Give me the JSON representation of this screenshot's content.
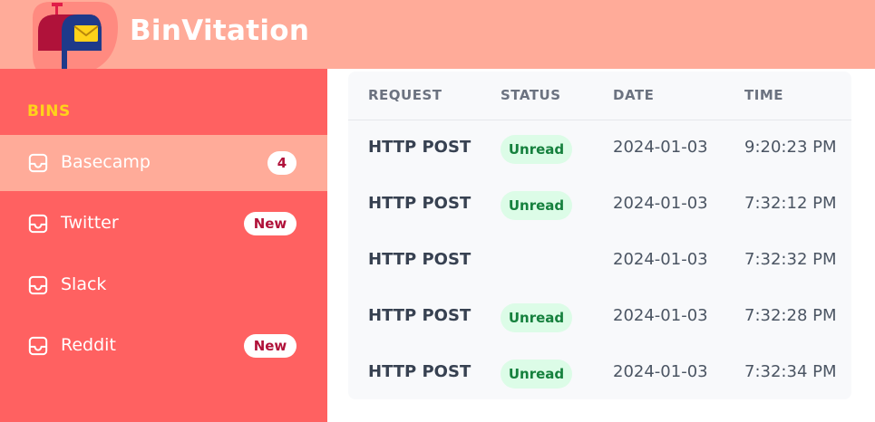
{
  "header": {
    "title": "BinVitation",
    "logo_icon": "mailbox-icon"
  },
  "sidebar": {
    "heading": "BINS",
    "items": [
      {
        "label": "Basecamp",
        "badge": "4",
        "icon": "inbox-icon",
        "active": true
      },
      {
        "label": "Twitter",
        "badge": "New",
        "icon": "inbox-icon",
        "active": false
      },
      {
        "label": "Slack",
        "badge": "",
        "icon": "inbox-icon",
        "active": false
      },
      {
        "label": "Reddit",
        "badge": "New",
        "icon": "inbox-icon",
        "active": false
      }
    ]
  },
  "table": {
    "columns": [
      "REQUEST",
      "STATUS",
      "DATE",
      "TIME"
    ],
    "rows": [
      {
        "request": "HTTP POST",
        "status": "Unread",
        "date": "2024-01-03",
        "time": "9:20:23 PM"
      },
      {
        "request": "HTTP POST",
        "status": "Unread",
        "date": "2024-01-03",
        "time": "7:32:12 PM"
      },
      {
        "request": "HTTP POST",
        "status": "",
        "date": "2024-01-03",
        "time": "7:32:32 PM"
      },
      {
        "request": "HTTP POST",
        "status": "Unread",
        "date": "2024-01-03",
        "time": "7:32:28 PM"
      },
      {
        "request": "HTTP POST",
        "status": "Unread",
        "date": "2024-01-03",
        "time": "7:32:34 PM"
      }
    ]
  },
  "colors": {
    "header_bg": "#ffab99",
    "sidebar_bg": "#ff6161",
    "sidebar_active_bg": "#ffab99",
    "heading_accent": "#ffd21a",
    "badge_text": "#b0123a",
    "status_unread_bg": "#dcfce7",
    "status_unread_text": "#15803d"
  }
}
